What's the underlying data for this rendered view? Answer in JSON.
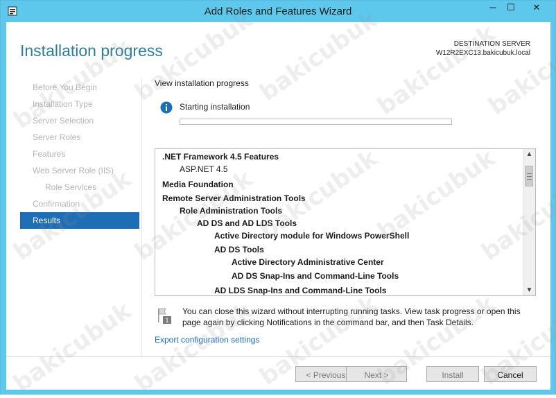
{
  "window": {
    "title": "Add Roles and Features Wizard",
    "minimize_glyph": "─",
    "maximize_glyph": "☐",
    "close_glyph": "✕"
  },
  "header": {
    "title": "Installation progress",
    "destination_label": "DESTINATION SERVER",
    "destination_value": "W12R2EXC13.bakicubuk.local"
  },
  "nav": {
    "items": [
      {
        "label": "Before You Begin"
      },
      {
        "label": "Installation Type"
      },
      {
        "label": "Server Selection"
      },
      {
        "label": "Server Roles"
      },
      {
        "label": "Features"
      },
      {
        "label": "Web Server Role (IIS)"
      },
      {
        "label": "Role Services"
      },
      {
        "label": "Confirmation"
      },
      {
        "label": "Results"
      }
    ],
    "active_index": 8
  },
  "main": {
    "title": "View installation progress",
    "status_text": "Starting installation",
    "progress_fraction": 0,
    "features": [
      {
        "label": ".NET Framework 4.5 Features"
      },
      {
        "label": "ASP.NET 4.5"
      },
      {
        "label": "Media Foundation"
      },
      {
        "label": "Remote Server Administration Tools"
      },
      {
        "label": "Role Administration Tools"
      },
      {
        "label": "AD DS and AD LDS Tools"
      },
      {
        "label": "Active Directory module for Windows PowerShell"
      },
      {
        "label": "AD DS Tools"
      },
      {
        "label": "Active Directory Administrative Center"
      },
      {
        "label": "AD DS Snap-Ins and Command-Line Tools"
      },
      {
        "label": "AD LDS Snap-Ins and Command-Line Tools"
      }
    ],
    "note_text": "You can close this wizard without interrupting running tasks. View task progress or open this page again by clicking Notifications in the command bar, and then Task Details.",
    "flag_badge": "1",
    "export_link": "Export configuration settings"
  },
  "buttons": {
    "previous": "< Previous",
    "next": "Next >",
    "install": "Install",
    "cancel": "Cancel"
  },
  "watermark": {
    "text": "bakicubuk"
  },
  "colors": {
    "titlebar": "#5ec8ec",
    "accent": "#1e6eb5",
    "header_title": "#2e7d9a"
  }
}
